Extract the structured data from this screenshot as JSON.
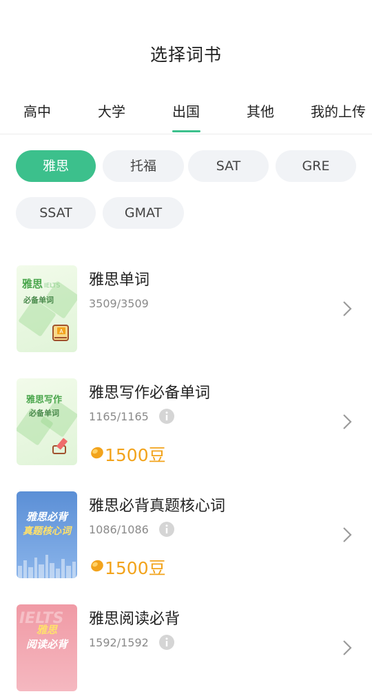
{
  "header": {
    "title": "选择词书"
  },
  "tabs": [
    {
      "label": "高中",
      "active": false
    },
    {
      "label": "大学",
      "active": false
    },
    {
      "label": "出国",
      "active": true
    },
    {
      "label": "其他",
      "active": false
    },
    {
      "label": "我的上传",
      "active": false
    }
  ],
  "categories": [
    {
      "label": "雅思",
      "active": true
    },
    {
      "label": "托福",
      "active": false
    },
    {
      "label": "SAT",
      "active": false
    },
    {
      "label": "GRE",
      "active": false
    },
    {
      "label": "SSAT",
      "active": false
    },
    {
      "label": "GMAT",
      "active": false
    }
  ],
  "books": [
    {
      "title": "雅思单词",
      "count": "3509/3509",
      "cover": {
        "line1": "雅思",
        "line1_small": "IELTS",
        "line2": "必备单词"
      }
    },
    {
      "title": "雅思写作必备单词",
      "count": "1165/1165",
      "price": "1500豆",
      "cover": {
        "line1": "雅思写作",
        "line2": "必备单词"
      }
    },
    {
      "title": "雅思必背真题核心词",
      "count": "1086/1086",
      "price": "1500豆",
      "cover": {
        "line1": "雅思必背",
        "line2": "真题核心词"
      }
    },
    {
      "title": "雅思阅读必背",
      "count": "1592/1592",
      "cover": {
        "watermark": "IELTS",
        "line1": "雅思",
        "line2": "阅读必背"
      }
    }
  ],
  "colors": {
    "accent": "#3cc08c",
    "price": "#f2a31c",
    "chip_bg": "#f1f3f6"
  },
  "icons": {
    "info": "info-icon",
    "chevron": "chevron-right-icon",
    "bean": "bean-coin-icon"
  }
}
